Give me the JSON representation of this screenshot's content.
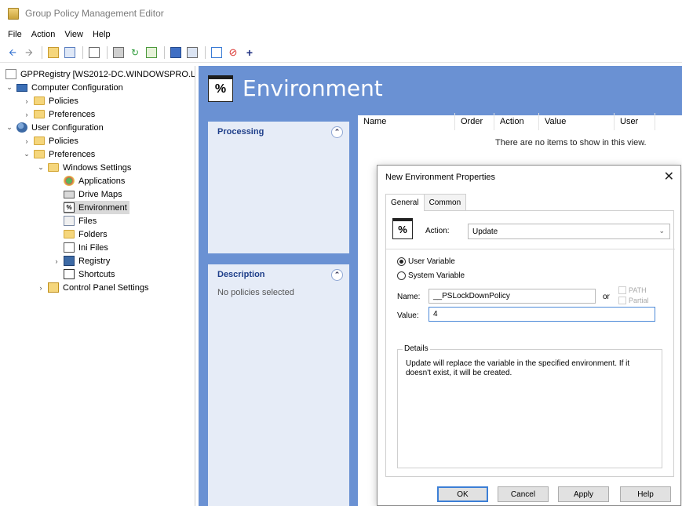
{
  "window": {
    "title": "Group Policy Management Editor"
  },
  "menu": [
    "File",
    "Action",
    "View",
    "Help"
  ],
  "toolbar": {
    "icons": [
      "back-arrow-icon",
      "forward-arrow-icon",
      "up-folder-icon",
      "show-hide-tree-icon",
      "properties-icon",
      "print-icon",
      "refresh-icon",
      "export-list-icon",
      "help-icon",
      "view-icon",
      "new-item-icon",
      "delete-icon",
      "add-icon"
    ]
  },
  "tree": {
    "root": "GPPRegistry [WS2012-DC.WINDOWSPRO.L",
    "computer_config": "Computer Configuration",
    "cc_policies": "Policies",
    "cc_preferences": "Preferences",
    "user_config": "User Configuration",
    "uc_policies": "Policies",
    "uc_preferences": "Preferences",
    "windows_settings": "Windows Settings",
    "applications": "Applications",
    "drive_maps": "Drive Maps",
    "environment": "Environment",
    "files": "Files",
    "folders": "Folders",
    "ini_files": "Ini Files",
    "registry": "Registry",
    "shortcuts": "Shortcuts",
    "control_panel": "Control Panel Settings"
  },
  "banner": {
    "title": "Environment",
    "icon_text": "%"
  },
  "panels": {
    "processing": {
      "title": "Processing"
    },
    "description": {
      "title": "Description",
      "body": "No policies selected"
    }
  },
  "list": {
    "columns": [
      "Name",
      "Order",
      "Action",
      "Value",
      "User"
    ],
    "empty_message": "There are no items to show in this view."
  },
  "dialog": {
    "title": "New Environment Properties",
    "tabs": [
      "General",
      "Common"
    ],
    "icon_text": "%",
    "action_label": "Action:",
    "action_value": "Update",
    "user_variable": "User Variable",
    "system_variable": "System Variable",
    "name_label": "Name:",
    "name_value": "__PSLockDownPolicy",
    "or_label": "or",
    "path_label": "PATH",
    "partial_label": "Partial",
    "value_label": "Value:",
    "value_value": "4",
    "details_legend": "Details",
    "details_text": "Update will replace the variable in the specified environment. If it doesn't exist, it will be created.",
    "buttons": {
      "ok": "OK",
      "cancel": "Cancel",
      "apply": "Apply",
      "help": "Help"
    }
  }
}
